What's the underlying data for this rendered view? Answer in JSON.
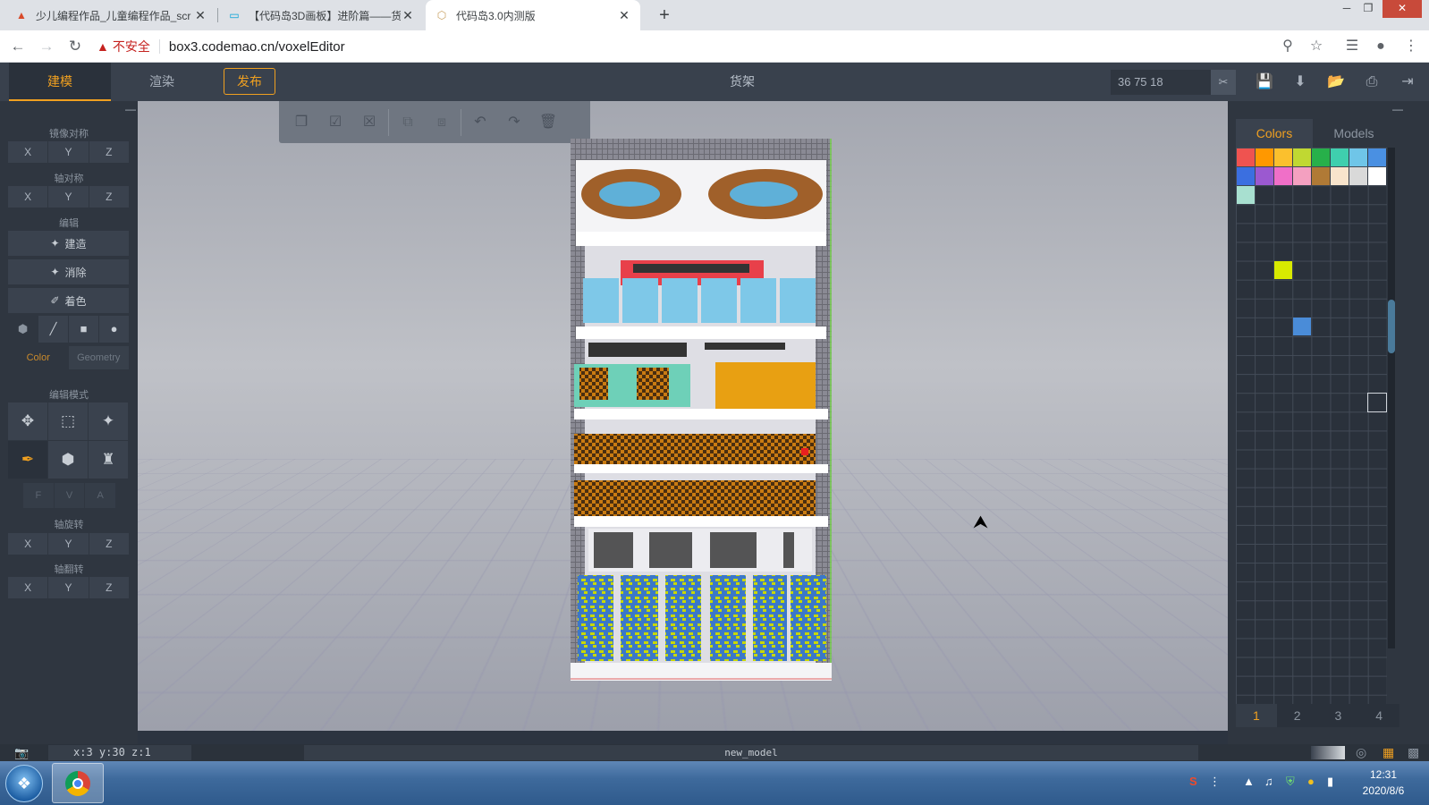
{
  "browser": {
    "tabs": [
      {
        "title": "少儿编程作品_儿童编程作品_scr",
        "icon": "codemao-icon"
      },
      {
        "title": "【代码岛3D画板】进阶篇——货",
        "icon": "bilibili-icon"
      },
      {
        "title": "代码岛3.0内测版",
        "icon": "box3-icon"
      }
    ],
    "security_label": "不安全",
    "url": "box3.codemao.cn/voxelEditor"
  },
  "app": {
    "modes": [
      "建模",
      "渲染"
    ],
    "publish_label": "发布",
    "model_title": "货架",
    "dimensions": "36  75  18",
    "colors": {
      "accent": "#f0a020",
      "panel": "#2f3640",
      "header": "#39414d"
    }
  },
  "left_panel": {
    "mirror_title": "镜像对称",
    "axis_sym_title": "轴对称",
    "edit_title": "编辑",
    "edit_buttons": [
      "建造",
      "消除",
      "着色"
    ],
    "color_label": "Color",
    "geometry_label": "Geometry",
    "edit_mode_title": "编辑模式",
    "fva": [
      "F",
      "V",
      "A"
    ],
    "axis_rotate_title": "轴旋转",
    "axis_flip_title": "轴翻转",
    "axes": [
      "X",
      "Y",
      "Z"
    ]
  },
  "right_panel": {
    "tabs": [
      "Colors",
      "Models"
    ],
    "palette": [
      "#ef5350",
      "#ff9800",
      "#fbc02d",
      "#c0d832",
      "#27b04a",
      "#3fcfae",
      "#6fc5e8",
      "#4a90e2",
      "#3b6fe0",
      "#9b59d0",
      "#f06fc8",
      "#f4a0c0",
      "#b07a36",
      "#f8e4cc",
      "#d9d9d9",
      "#ffffff",
      "#a8e0d0"
    ],
    "placed_colors": [
      "#d8ea00",
      "#4a8cd8"
    ],
    "pages": [
      "1",
      "2",
      "3",
      "4"
    ]
  },
  "status": {
    "coords": "x:3 y:30 z:1",
    "model_name": "new_model"
  },
  "taskbar": {
    "time": "12:31",
    "date": "2020/8/6"
  }
}
